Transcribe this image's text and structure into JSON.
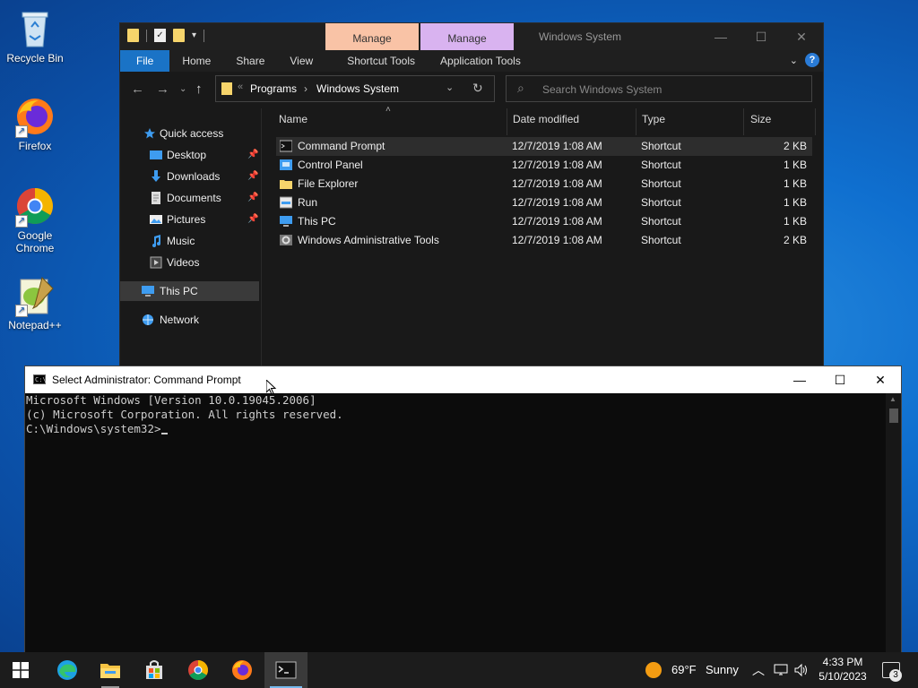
{
  "desktop": {
    "icons": [
      {
        "label": "Recycle Bin"
      },
      {
        "label": "Firefox"
      },
      {
        "label": "Google Chrome"
      },
      {
        "label": "Notepad++"
      }
    ]
  },
  "explorer": {
    "title": "Windows System",
    "context_tabs": [
      "Manage",
      "Manage"
    ],
    "ribbon_tabs": [
      "File",
      "Home",
      "Share",
      "View",
      "Shortcut Tools",
      "Application Tools"
    ],
    "breadcrumb": [
      "Programs",
      "Windows System"
    ],
    "search_placeholder": "Search Windows System",
    "nav": {
      "quick_access": "Quick access",
      "items": [
        "Desktop",
        "Downloads",
        "Documents",
        "Pictures",
        "Music",
        "Videos"
      ],
      "this_pc": "This PC",
      "network": "Network"
    },
    "columns": [
      "Name",
      "Date modified",
      "Type",
      "Size"
    ],
    "files": [
      {
        "name": "Command Prompt",
        "date": "12/7/2019 1:08 AM",
        "type": "Shortcut",
        "size": "2 KB"
      },
      {
        "name": "Control Panel",
        "date": "12/7/2019 1:08 AM",
        "type": "Shortcut",
        "size": "1 KB"
      },
      {
        "name": "File Explorer",
        "date": "12/7/2019 1:08 AM",
        "type": "Shortcut",
        "size": "1 KB"
      },
      {
        "name": "Run",
        "date": "12/7/2019 1:08 AM",
        "type": "Shortcut",
        "size": "1 KB"
      },
      {
        "name": "This PC",
        "date": "12/7/2019 1:08 AM",
        "type": "Shortcut",
        "size": "1 KB"
      },
      {
        "name": "Windows Administrative Tools",
        "date": "12/7/2019 1:08 AM",
        "type": "Shortcut",
        "size": "2 KB"
      }
    ]
  },
  "cmd": {
    "title": "Select Administrator: Command Prompt",
    "lines": [
      "Microsoft Windows [Version 10.0.19045.2006]",
      "(c) Microsoft Corporation. All rights reserved.",
      "",
      "C:\\Windows\\system32>"
    ]
  },
  "taskbar": {
    "weather_temp": "69°F",
    "weather_cond": "Sunny",
    "time": "4:33 PM",
    "date": "5/10/2023",
    "notification_count": "3"
  }
}
